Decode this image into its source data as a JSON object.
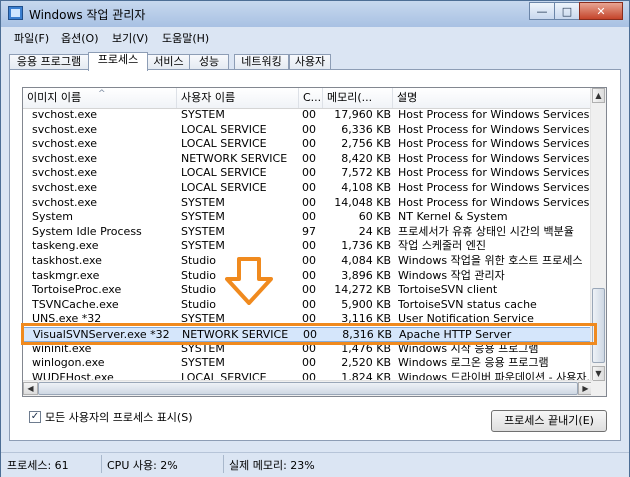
{
  "window": {
    "title": "Windows 작업 관리자",
    "min": "—",
    "max": "□",
    "close": "✕"
  },
  "menu": [
    "파일(F)",
    "옵션(O)",
    "보기(V)",
    "도움말(H)"
  ],
  "tabs": [
    "응용 프로그램",
    "프로세스",
    "서비스",
    "성능",
    "네트워킹",
    "사용자"
  ],
  "columns": [
    "이미지 이름",
    "사용자 이름",
    "C...",
    "메모리(...",
    "설명"
  ],
  "rows": [
    [
      "svchost.exe",
      "SYSTEM",
      "00",
      "17,960 KB",
      "Host Process for Windows Services"
    ],
    [
      "svchost.exe",
      "LOCAL SERVICE",
      "00",
      "6,336 KB",
      "Host Process for Windows Services"
    ],
    [
      "svchost.exe",
      "LOCAL SERVICE",
      "00",
      "2,756 KB",
      "Host Process for Windows Services"
    ],
    [
      "svchost.exe",
      "NETWORK SERVICE",
      "00",
      "8,420 KB",
      "Host Process for Windows Services"
    ],
    [
      "svchost.exe",
      "LOCAL SERVICE",
      "00",
      "7,572 KB",
      "Host Process for Windows Services"
    ],
    [
      "svchost.exe",
      "LOCAL SERVICE",
      "00",
      "4,108 KB",
      "Host Process for Windows Services"
    ],
    [
      "svchost.exe",
      "SYSTEM",
      "00",
      "14,048 KB",
      "Host Process for Windows Services"
    ],
    [
      "System",
      "SYSTEM",
      "00",
      "60 KB",
      "NT Kernel & System"
    ],
    [
      "System Idle Process",
      "SYSTEM",
      "97",
      "24 KB",
      "프로세서가 유휴 상태인 시간의 백분율"
    ],
    [
      "taskeng.exe",
      "SYSTEM",
      "00",
      "1,736 KB",
      "작업 스케줄러 엔진"
    ],
    [
      "taskhost.exe",
      "Studio",
      "00",
      "4,084 KB",
      "Windows 작업을 위한 호스트 프로세스"
    ],
    [
      "taskmgr.exe",
      "Studio",
      "00",
      "3,896 KB",
      "Windows 작업 관리자"
    ],
    [
      "TortoiseProc.exe",
      "Studio",
      "00",
      "14,272 KB",
      "TortoiseSVN client"
    ],
    [
      "TSVNCache.exe",
      "Studio",
      "00",
      "5,900 KB",
      "TortoiseSVN status cache"
    ],
    [
      "UNS.exe *32",
      "SYSTEM",
      "00",
      "3,116 KB",
      "User Notification Service"
    ],
    [
      "VisualSVNServer.exe *32",
      "NETWORK SERVICE",
      "00",
      "8,316 KB",
      "Apache HTTP Server"
    ],
    [
      "wininit.exe",
      "SYSTEM",
      "00",
      "1,476 KB",
      "Windows 시작 응용 프로그램"
    ],
    [
      "winlogon.exe",
      "SYSTEM",
      "00",
      "2,520 KB",
      "Windows 로그온 응용 프로그램"
    ],
    [
      "WUDFHost.exe",
      "LOCAL SERVICE",
      "00",
      "1,824 KB",
      "Windows 드라이버 파운데이션 - 사용자..."
    ]
  ],
  "selected_row": 15,
  "show_all_users": "모든 사용자의 프로세스 표시(S)",
  "end_process": "프로세스 끝내기(E)",
  "status": {
    "processes": "프로세스: 61",
    "cpu": "CPU 사용: 2%",
    "memory": "실제 메모리: 23%"
  },
  "colors": {
    "highlight": "#f08a1e",
    "selection": "#d5e6fb"
  }
}
